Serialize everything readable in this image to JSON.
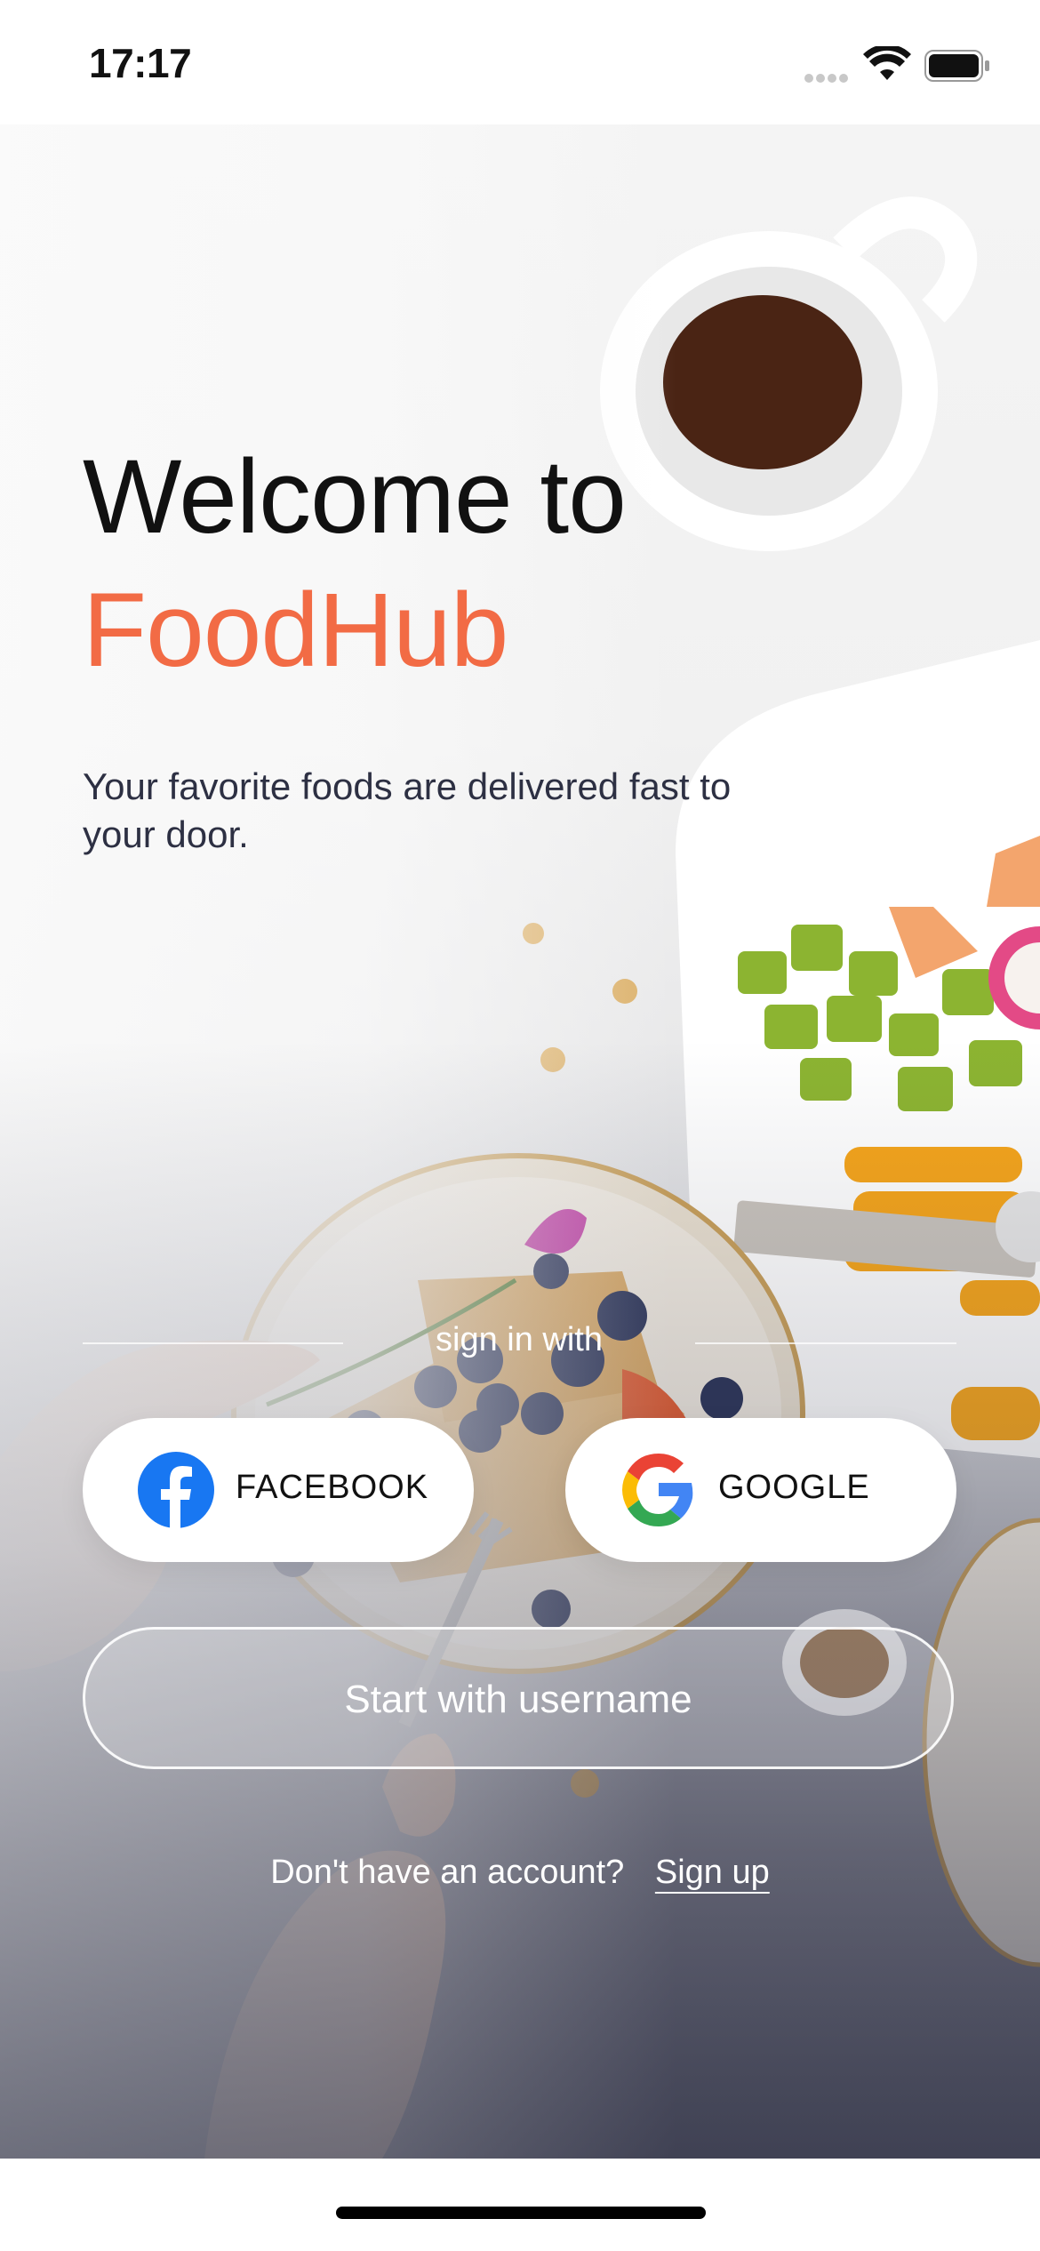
{
  "status_bar": {
    "time": "17:17"
  },
  "welcome": {
    "line1": "Welcome to",
    "brand": "FoodHub",
    "tagline": "Your favorite foods are delivered fast to your door."
  },
  "signin": {
    "label": "sign in with",
    "facebook_label": "FACEBOOK",
    "google_label": "GOOGLE",
    "username_label": "Start with username"
  },
  "footer": {
    "question": "Don't have an account?",
    "signup_link": "Sign up"
  },
  "colors": {
    "brand": "#f26b45",
    "facebook": "#1877f2",
    "text_dark": "#111111"
  },
  "icons": {
    "facebook": "facebook-icon",
    "google": "google-icon",
    "wifi": "wifi-icon",
    "battery": "battery-icon"
  }
}
